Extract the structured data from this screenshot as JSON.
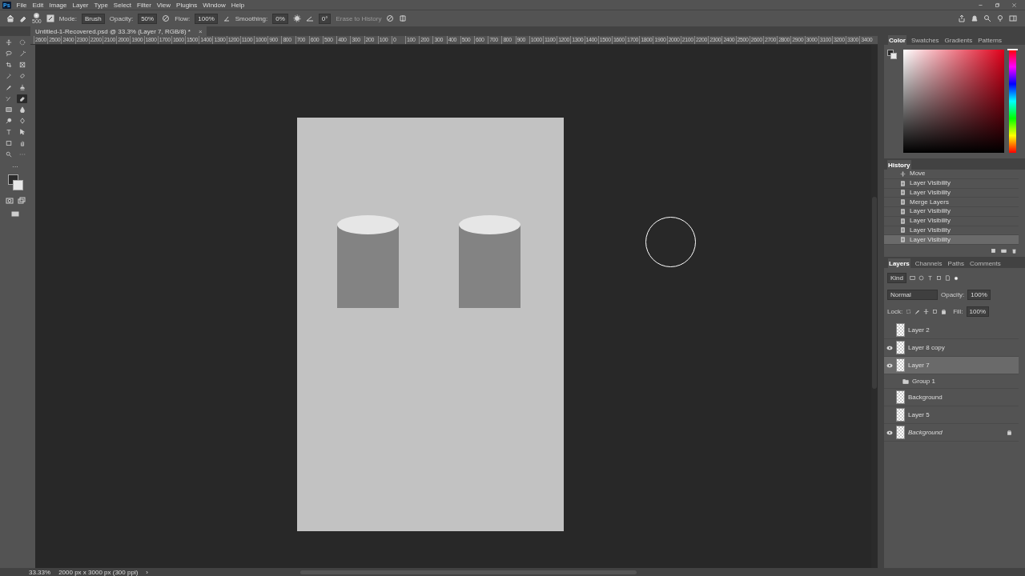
{
  "app_logo": "Ps",
  "menu": [
    "File",
    "Edit",
    "Image",
    "Layer",
    "Type",
    "Select",
    "Filter",
    "View",
    "Plugins",
    "Window",
    "Help"
  ],
  "options_bar": {
    "brush_size": "500",
    "mode_label": "Mode:",
    "mode": "Brush",
    "opacity_label": "Opacity:",
    "opacity": "50%",
    "flow_label": "Flow:",
    "flow": "100%",
    "smoothing_label": "Smoothing:",
    "smoothing": "0%",
    "angle": "0°",
    "erase_to_history": {
      "label": "Erase to History",
      "disabled": true
    }
  },
  "document_tab": {
    "title": "Untitled-1-Recovered.psd @ 33.3% (Layer 7, RGB/8) *",
    "close": "×"
  },
  "tools": [
    {
      "selected": false
    },
    {
      "selected": false
    },
    {
      "selected": false
    },
    {
      "selected": false
    },
    {
      "selected": false
    },
    {
      "selected": false
    },
    {
      "selected": false
    },
    {
      "selected": false
    },
    {
      "selected": false
    },
    {
      "selected": false
    },
    {
      "selected": false
    },
    {
      "selected": true
    },
    {
      "selected": false
    },
    {
      "selected": false
    },
    {
      "selected": false
    },
    {
      "selected": false
    },
    {
      "selected": false
    },
    {
      "selected": false
    },
    {
      "selected": false
    },
    {
      "selected": false
    },
    {
      "selected": false
    },
    {
      "selected": false
    }
  ],
  "toolbar_more": "···",
  "ruler": [
    "2600",
    "2500",
    "2400",
    "2300",
    "2200",
    "2100",
    "2000",
    "1900",
    "1800",
    "1700",
    "1600",
    "1500",
    "1400",
    "1300",
    "1200",
    "1100",
    "1000",
    "900",
    "800",
    "700",
    "600",
    "500",
    "400",
    "300",
    "200",
    "100",
    "0",
    "100",
    "200",
    "300",
    "400",
    "500",
    "600",
    "700",
    "800",
    "900",
    "1000",
    "1100",
    "1200",
    "1300",
    "1400",
    "1500",
    "1600",
    "1700",
    "1800",
    "1900",
    "2000",
    "2100",
    "2200",
    "2300",
    "2400",
    "2500",
    "2600",
    "2700",
    "2800",
    "2900",
    "3000",
    "3100",
    "3200",
    "3300",
    "3400"
  ],
  "color_panel": {
    "hue_slider": {
      "level": 1
    },
    "tabs": [
      {
        "label": "Color",
        "selected": true
      },
      {
        "label": "Swatches",
        "selected": false
      },
      {
        "label": "Gradients",
        "selected": false
      },
      {
        "label": "Patterns",
        "selected": false
      }
    ]
  },
  "history": {
    "title": "History",
    "items": [
      {
        "label": "Move",
        "kind": "move",
        "selected": false
      },
      {
        "label": "Layer Visibility",
        "kind": "doc",
        "selected": false
      },
      {
        "label": "Layer Visibility",
        "kind": "doc",
        "selected": false
      },
      {
        "label": "Merge Layers",
        "kind": "doc",
        "selected": false
      },
      {
        "label": "Layer Visibility",
        "kind": "doc",
        "selected": false
      },
      {
        "label": "Layer Visibility",
        "kind": "doc",
        "selected": false
      },
      {
        "label": "Layer Visibility",
        "kind": "doc",
        "selected": false
      },
      {
        "label": "Layer Visibility",
        "kind": "doc",
        "selected": true
      }
    ]
  },
  "layers_panel": {
    "tabs": [
      {
        "label": "Layers",
        "selected": true
      },
      {
        "label": "Channels",
        "selected": false
      },
      {
        "label": "Paths",
        "selected": false
      },
      {
        "label": "Comments",
        "selected": false
      }
    ],
    "filter": "Kind",
    "blend_mode": "Normal",
    "opacity_label": "Opacity:",
    "opacity": "100%",
    "lock_label": "Lock:",
    "fill_label": "Fill:",
    "fill": "100%",
    "layers": [
      {
        "name": "Layer 2",
        "kind": "layer",
        "visible": false,
        "selected": false,
        "locked": false,
        "italic": false
      },
      {
        "name": "Layer 8 copy",
        "kind": "layer",
        "visible": true,
        "selected": false,
        "locked": false,
        "italic": false
      },
      {
        "name": "Layer 7",
        "kind": "layer",
        "visible": true,
        "selected": true,
        "locked": false,
        "italic": false
      },
      {
        "name": "Group 1",
        "kind": "group",
        "visible": false,
        "selected": false,
        "locked": false,
        "italic": false
      },
      {
        "name": "Background",
        "kind": "layer",
        "visible": false,
        "selected": false,
        "locked": false,
        "italic": false
      },
      {
        "name": "Layer 5",
        "kind": "layer",
        "visible": false,
        "selected": false,
        "locked": false,
        "italic": false
      },
      {
        "name": "Background",
        "kind": "layer",
        "visible": true,
        "selected": false,
        "locked": true,
        "italic": true
      }
    ]
  },
  "status_bar": {
    "zoom": "33.33%",
    "doc_size": "2000 px x 3000 px (300 ppi)",
    "arrow": "›"
  }
}
